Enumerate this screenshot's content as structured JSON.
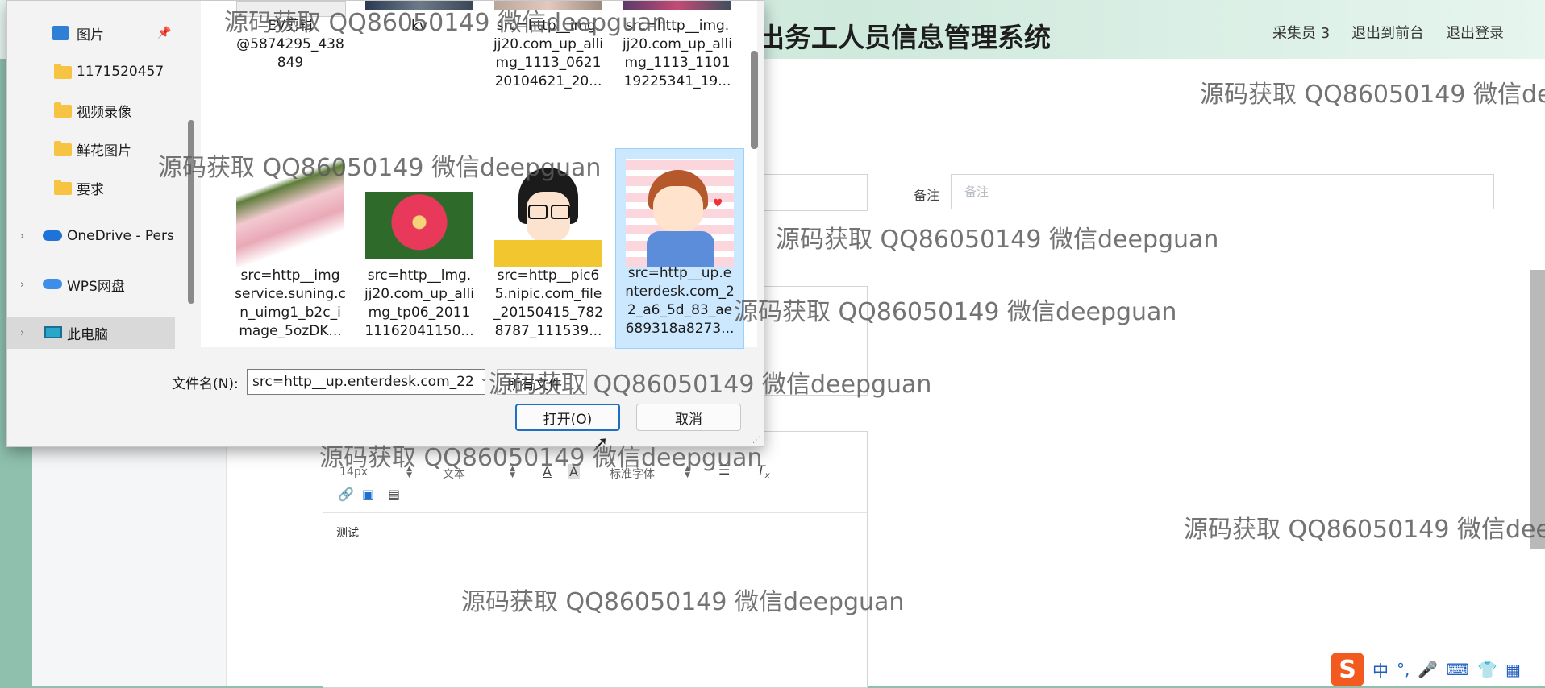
{
  "app": {
    "title": "出务工人员信息管理系统",
    "nav": [
      "采集员 3",
      "退出到前台",
      "退出登录"
    ],
    "remark": {
      "label": "备注",
      "placeholder": "备注"
    },
    "editor": {
      "font_size": "14px",
      "block_type": "文本",
      "font_family": "标准字体",
      "content": "测试"
    }
  },
  "dialog": {
    "nav_items": [
      {
        "label": "图片",
        "icon": "pictures-folder-icon",
        "pinned": true
      },
      {
        "label": "1171520457",
        "icon": "folder-icon"
      },
      {
        "label": "视频录像",
        "icon": "folder-icon"
      },
      {
        "label": "鲜花图片",
        "icon": "folder-icon"
      },
      {
        "label": "要求",
        "icon": "folder-icon"
      },
      {
        "label": "OneDrive - Pers",
        "icon": "onedrive-cloud-icon"
      },
      {
        "label": "WPS网盘",
        "icon": "wps-cloud-icon"
      },
      {
        "label": "此电脑",
        "icon": "this-pc-icon",
        "selected": true
      }
    ],
    "files": [
      {
        "name": "EV剪辑\n@5874295_438\n849",
        "thumb": "ev-thumb"
      },
      {
        "name": "kv",
        "thumb": "car-thumb"
      },
      {
        "name": "src=http__img.\njj20.com_up_alli\nmg_1113_0621\n20104621_20...",
        "thumb": "flowers-thumb"
      },
      {
        "name": "src=http__img.\njj20.com_up_alli\nmg_1113_1101\n19225341_19...",
        "thumb": "bouquet-thumb"
      },
      {
        "name": "src=http__img\nservice.suning.c\nn_uimg1_b2c_i\nmage_5ozDK...",
        "thumb": "gift-box-thumb"
      },
      {
        "name": "src=http__lmg.\njj20.com_up_alli\nmg_tp06_2011\n11162041150...",
        "thumb": "gerbera-thumb"
      },
      {
        "name": "src=http__pic6\n5.nipic.com_file\n_20150415_782\n8787_111539...",
        "thumb": "cartoon-girl-thumb"
      },
      {
        "name": "src=http__up.e\nnterdesk.com_2\n2_a6_5d_83_ae\n689318a8273...",
        "thumb": "cartoon-boy-thumb",
        "selected": true
      }
    ],
    "filename_label": "文件名(N):",
    "filename_value": "src=http__up.enterdesk.com_22",
    "filter_label": "所有文件",
    "open_label": "打开(O)",
    "cancel_label": "取消"
  },
  "watermark": "源码获取 QQ86050149 微信deepguan",
  "ime": {
    "logo": "S",
    "items": [
      "中",
      "°,",
      "🎤",
      "⌨",
      "👕",
      "▦"
    ]
  }
}
